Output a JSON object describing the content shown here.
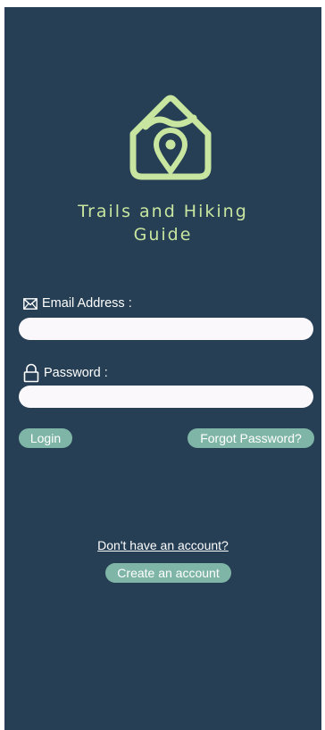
{
  "app": {
    "title": "Trails and Hiking\nGuide",
    "accent_color": "#c8e6a0",
    "background_color": "#263f55",
    "button_color": "#7fb5a6"
  },
  "login_form": {
    "email_icon": "envelope-icon",
    "email_label": "Email Address :",
    "email_value": "",
    "password_icon": "lock-icon",
    "password_label": "Password :",
    "password_value": ""
  },
  "actions": {
    "login_label": "Login",
    "forgot_label": "Forgot Password?"
  },
  "signup": {
    "prompt": "Don't have an account?",
    "create_label": "Create an account"
  }
}
